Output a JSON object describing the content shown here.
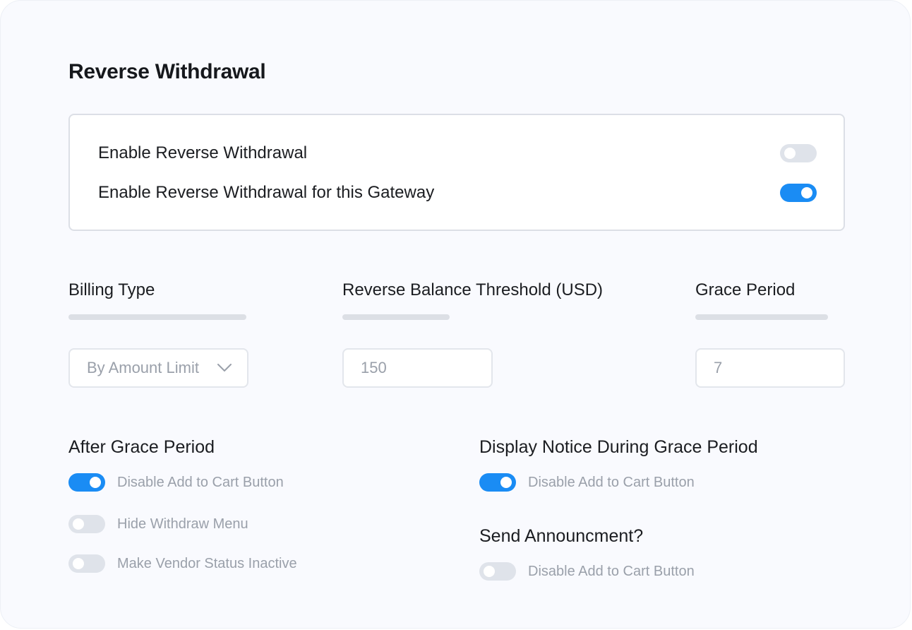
{
  "page": {
    "title": "Reverse Withdrawal"
  },
  "enable_section": {
    "rows": [
      {
        "label": "Enable Reverse Withdrawal",
        "enabled": false
      },
      {
        "label": "Enable Reverse Withdrawal for this Gateway",
        "enabled": true
      }
    ]
  },
  "fields": {
    "billing_type": {
      "label": "Billing Type",
      "value": "By Amount Limit",
      "icon": "chevron-down-icon"
    },
    "threshold": {
      "label": "Reverse Balance Threshold (USD)",
      "value": "150"
    },
    "grace_period": {
      "label": "Grace Period",
      "value": "7"
    }
  },
  "after_grace": {
    "title": "After Grace Period",
    "options": [
      {
        "label": "Disable Add to Cart Button",
        "enabled": true
      },
      {
        "label": "Hide Withdraw Menu",
        "enabled": false
      },
      {
        "label": "Make Vendor Status Inactive",
        "enabled": false
      }
    ]
  },
  "display_notice": {
    "title": "Display Notice During Grace Period",
    "options": [
      {
        "label": "Disable Add to Cart Button",
        "enabled": true
      }
    ]
  },
  "send_announcement": {
    "title": "Send Announcment?",
    "options": [
      {
        "label": "Disable Add to Cart Button",
        "enabled": false
      }
    ]
  },
  "colors": {
    "accent": "#1a8cf4",
    "toggle_off": "#dfe3ea",
    "muted_text": "#9aa0aa",
    "background": "#f9fafe"
  }
}
